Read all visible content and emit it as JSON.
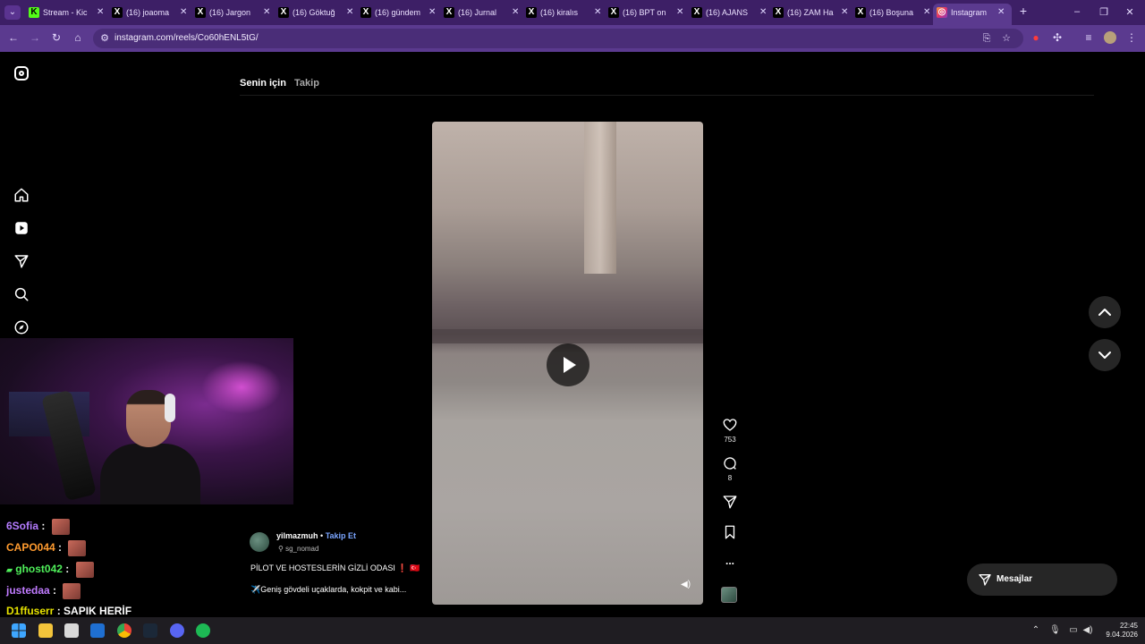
{
  "browser": {
    "tabs": [
      {
        "label": "Stream - Kic",
        "icon": "kick-icon",
        "color": "#53fc18"
      },
      {
        "label": "(16) joaoma",
        "icon": "x-icon",
        "color": "#000000"
      },
      {
        "label": "(16) Jargon",
        "icon": "x-icon",
        "color": "#000000"
      },
      {
        "label": "(16) Göktuğ",
        "icon": "x-icon",
        "color": "#000000"
      },
      {
        "label": "(16) gündem",
        "icon": "x-icon",
        "color": "#000000"
      },
      {
        "label": "(16) Jurnal",
        "icon": "x-icon",
        "color": "#000000"
      },
      {
        "label": "(16) kiralıs",
        "icon": "x-icon",
        "color": "#000000"
      },
      {
        "label": "(16) BPT on",
        "icon": "x-icon",
        "color": "#000000"
      },
      {
        "label": "(16) AJANS",
        "icon": "x-icon",
        "color": "#000000"
      },
      {
        "label": "(16) ZAM Ha",
        "icon": "x-icon",
        "color": "#000000"
      },
      {
        "label": "(16) Boşuna",
        "icon": "x-icon",
        "color": "#000000"
      },
      {
        "label": "Instagram",
        "icon": "instagram-icon",
        "color": "#e1306c",
        "active": true
      }
    ],
    "new_tab": "+",
    "url": "instagram.com/reels/Co60hENL5tG/"
  },
  "instagram": {
    "feed_tabs": {
      "for_you": "Senin için",
      "following": "Takip"
    },
    "reel": {
      "author": "yilmazmuh",
      "separator": "•",
      "follow": "Takip Et",
      "audio": "sg_nomad",
      "caption_title": "PİLOT VE HOSTESLERİN GİZLİ ODASI ❗️ 🇹🇷",
      "caption_text": "✈️Geniş gövdeli uçaklarda, kokpit ve kabi...",
      "likes": "753",
      "comments": "8",
      "more": "..."
    },
    "messages_label": "Mesajlar"
  },
  "chat": [
    {
      "user": "6Sofia",
      "color": "#b57cff",
      "message": ""
    },
    {
      "user": "CAPO044",
      "color": "#ff9b2f",
      "message": ""
    },
    {
      "user": "ghost042",
      "color": "#4ff05a",
      "message": ""
    },
    {
      "user": "justedaa",
      "color": "#c07bff",
      "message": ""
    },
    {
      "user": "D1ffuserr",
      "color": "#e6e200",
      "message": "SAPIK HERİF"
    }
  ],
  "chat_separator": ":",
  "taskbar": {
    "time": "22:45",
    "date": "9.04.2026"
  }
}
